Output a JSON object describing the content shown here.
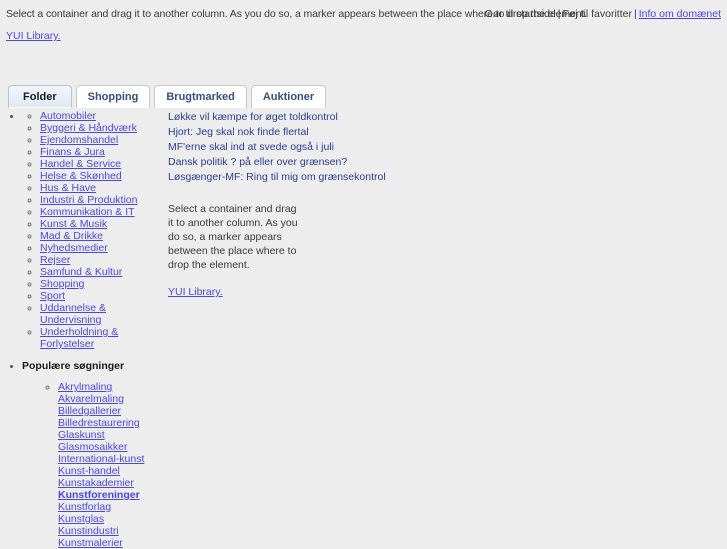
{
  "topbar": {
    "note": "Select a container and drag it to another column. As you do so, a marker appears between the place where to drop the element.",
    "link_home": "Gør til startside",
    "sep1": "|",
    "link_favorites": "Føj til favoritter",
    "sep2": "|",
    "link_domain_info": "Info om domænet",
    "yui_link": "YUI Library."
  },
  "tabs": [
    {
      "label": "Folder",
      "active": true
    },
    {
      "label": "Shopping",
      "active": false
    },
    {
      "label": "Brugtmarked",
      "active": false
    },
    {
      "label": "Auktioner",
      "active": false
    }
  ],
  "categories": [
    "Automobiler",
    "Byggeri & Håndværk",
    "Ejendomshandel",
    "Finans & Jura",
    "Handel & Service",
    "Helse & Skønhed",
    "Hus & Have",
    "Industri & Produktion",
    "Kommunikation & IT",
    "Kunst & Musik",
    "Mad & Drikke",
    "Nyhedsmedier",
    "Rejser",
    "Samfund & Kultur",
    "Shopping",
    "Sport",
    "Uddannelse & Undervisning",
    "Underholdning & Forlystelser"
  ],
  "popular": {
    "title": "Populære søgninger",
    "items": [
      {
        "label": "Akrylmaling",
        "bold": false
      },
      {
        "label": "Akvarelmaling",
        "bold": false
      },
      {
        "label": "Billedgallerier",
        "bold": false
      },
      {
        "label": "Billedrestaurering",
        "bold": false
      },
      {
        "label": "Glaskunst",
        "bold": false
      },
      {
        "label": "Glasmosaikker",
        "bold": false
      },
      {
        "label": "International-kunst",
        "bold": false
      },
      {
        "label": "Kunst-handel",
        "bold": false
      },
      {
        "label": "Kunstakademier",
        "bold": false
      },
      {
        "label": "Kunstforeninger",
        "bold": true
      },
      {
        "label": "Kunstforlag",
        "bold": false
      },
      {
        "label": "Kunstglas",
        "bold": false
      },
      {
        "label": "Kunstindustri",
        "bold": false
      },
      {
        "label": "Kunstmalerier",
        "bold": false
      }
    ]
  },
  "news": [
    "Løkke vil kæmpe for øget toldkontrol",
    "Hjort: Jeg skal nok finde flertal",
    "MF'erne skal ind at svede også i juli",
    "Dansk politik ? på eller over grænsen?",
    "Løsgænger-MF: Ring til mig om grænsekontrol"
  ],
  "middle": {
    "paragraph": "Select a container and drag it to another column. As you do so, a marker appears between the place where to drop the element.",
    "yui_link": "YUI Library."
  },
  "colors": {
    "background": "#ededed",
    "link": "#4a48d8",
    "news_text": "#2a3f8f",
    "tab_text": "#31527e"
  }
}
